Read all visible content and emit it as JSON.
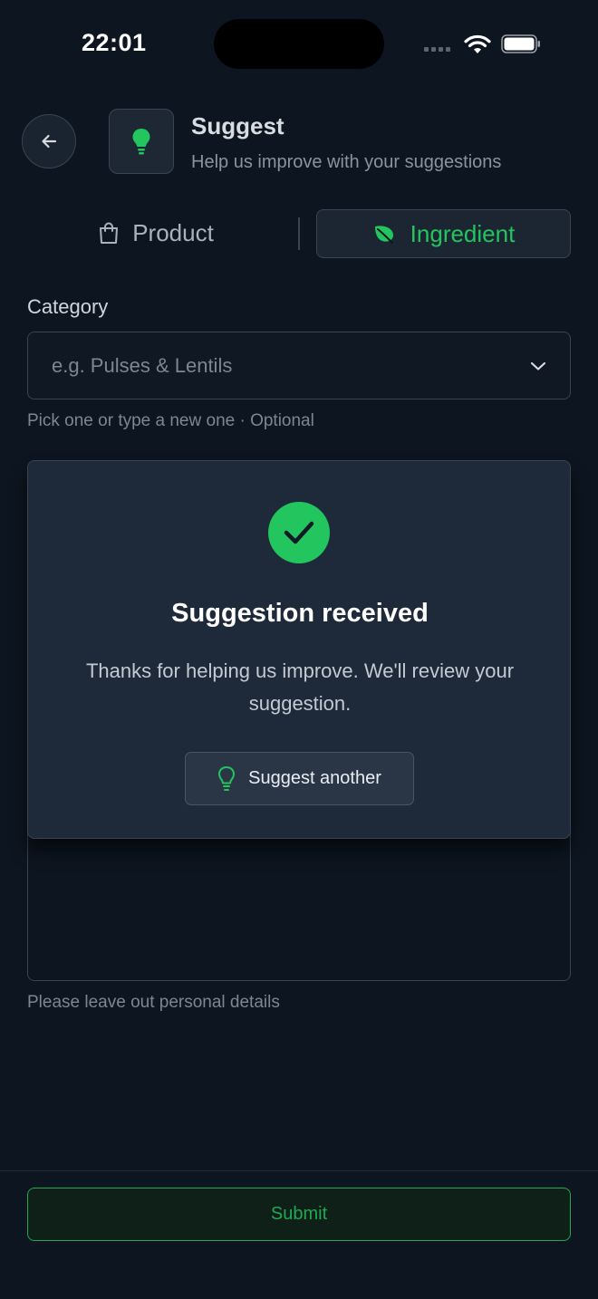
{
  "status_bar": {
    "time": "22:01",
    "signal_icon": "cellular-signal-icon",
    "wifi_icon": "wifi-icon",
    "battery_icon": "battery-icon"
  },
  "header": {
    "back_icon": "arrow-left-icon",
    "icon": "lightbulb-icon",
    "title": "Suggest",
    "subtitle": "Help us improve with your suggestions"
  },
  "tabs": [
    {
      "label": "Product",
      "icon": "shopping-bag-icon",
      "selected": false
    },
    {
      "label": "Ingredient",
      "icon": "leaf-icon",
      "selected": true
    }
  ],
  "category": {
    "label": "Category",
    "placeholder": "e.g. Pulses & Lentils",
    "helper": "Pick one or type a new one · Optional"
  },
  "description": {
    "helper": "Please leave out personal details"
  },
  "success_card": {
    "icon": "check-circle-icon",
    "title": "Suggestion received",
    "message": "Thanks for helping us improve. We'll review your suggestion.",
    "button_label": "Suggest another",
    "button_icon": "lightbulb-icon"
  },
  "footer": {
    "submit_label": "Submit"
  },
  "colors": {
    "background": "#0d1520",
    "accent": "#22c55e",
    "card": "#1e2939",
    "border": "#3a4452"
  }
}
